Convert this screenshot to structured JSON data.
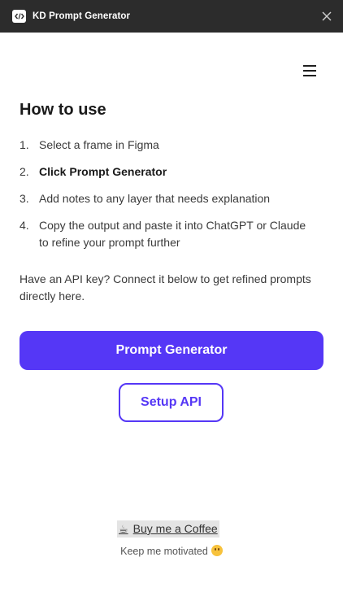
{
  "titlebar": {
    "title": "KD Prompt Generator",
    "icon": "code-icon",
    "close_icon": "close-icon"
  },
  "menu": {
    "icon": "hamburger-menu-icon"
  },
  "main": {
    "heading": "How to use",
    "steps": [
      {
        "num": "1.",
        "text": "Select a frame in Figma"
      },
      {
        "num": "2.",
        "text": "Click Prompt Generator"
      },
      {
        "num": "3.",
        "text": "Add notes to any layer that needs explanation"
      },
      {
        "num": "4.",
        "text": "Copy the output and paste it into ChatGPT or Claude to refine your prompt further"
      }
    ],
    "api_note": "Have an API key? Connect it below to get refined prompts directly here.",
    "primary_button": "Prompt Generator",
    "secondary_button": "Setup API"
  },
  "footer": {
    "coffee_icon": "☕",
    "coffee_label": "Buy me a Coffee",
    "motivate_text": "Keep me motivated"
  },
  "colors": {
    "accent": "#5537f6",
    "titlebar": "#2c2c2c"
  }
}
